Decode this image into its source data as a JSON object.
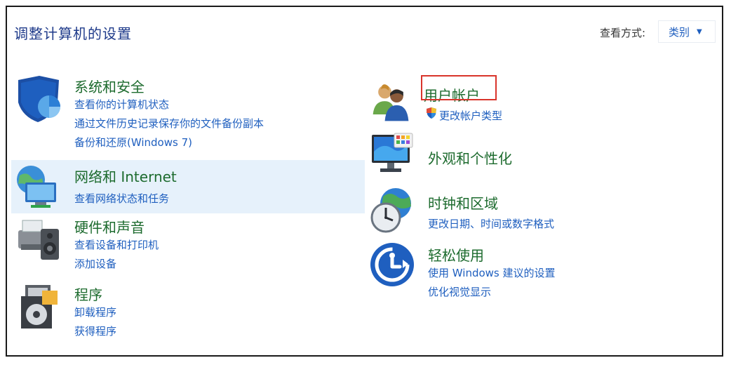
{
  "page": {
    "title": "调整计算机的设置"
  },
  "view": {
    "label": "查看方式:",
    "selected": "类别"
  },
  "categories": {
    "system": {
      "heading": "系统和安全",
      "links": [
        "查看你的计算机状态",
        "通过文件历史记录保存你的文件备份副本",
        "备份和还原(Windows 7)"
      ],
      "icon": "shield-icon"
    },
    "network": {
      "heading": "网络和 Internet",
      "links": [
        "查看网络状态和任务"
      ],
      "icon": "network-globe-icon"
    },
    "hardware": {
      "heading": "硬件和声音",
      "links": [
        "查看设备和打印机",
        "添加设备"
      ],
      "icon": "printer-speaker-icon"
    },
    "programs": {
      "heading": "程序",
      "links": [
        "卸载程序",
        "获得程序"
      ],
      "icon": "programs-disc-icon"
    },
    "users": {
      "heading": "用户帐户",
      "links": [
        "更改帐户类型"
      ],
      "icon": "users-icon"
    },
    "appearance": {
      "heading": "外观和个性化",
      "links": [],
      "icon": "monitor-palette-icon"
    },
    "clock": {
      "heading": "时钟和区域",
      "links": [
        "更改日期、时间或数字格式"
      ],
      "icon": "clock-globe-icon"
    },
    "ease": {
      "heading": "轻松使用",
      "links": [
        "使用 Windows 建议的设置",
        "优化视觉显示"
      ],
      "icon": "ease-of-access-icon"
    }
  }
}
